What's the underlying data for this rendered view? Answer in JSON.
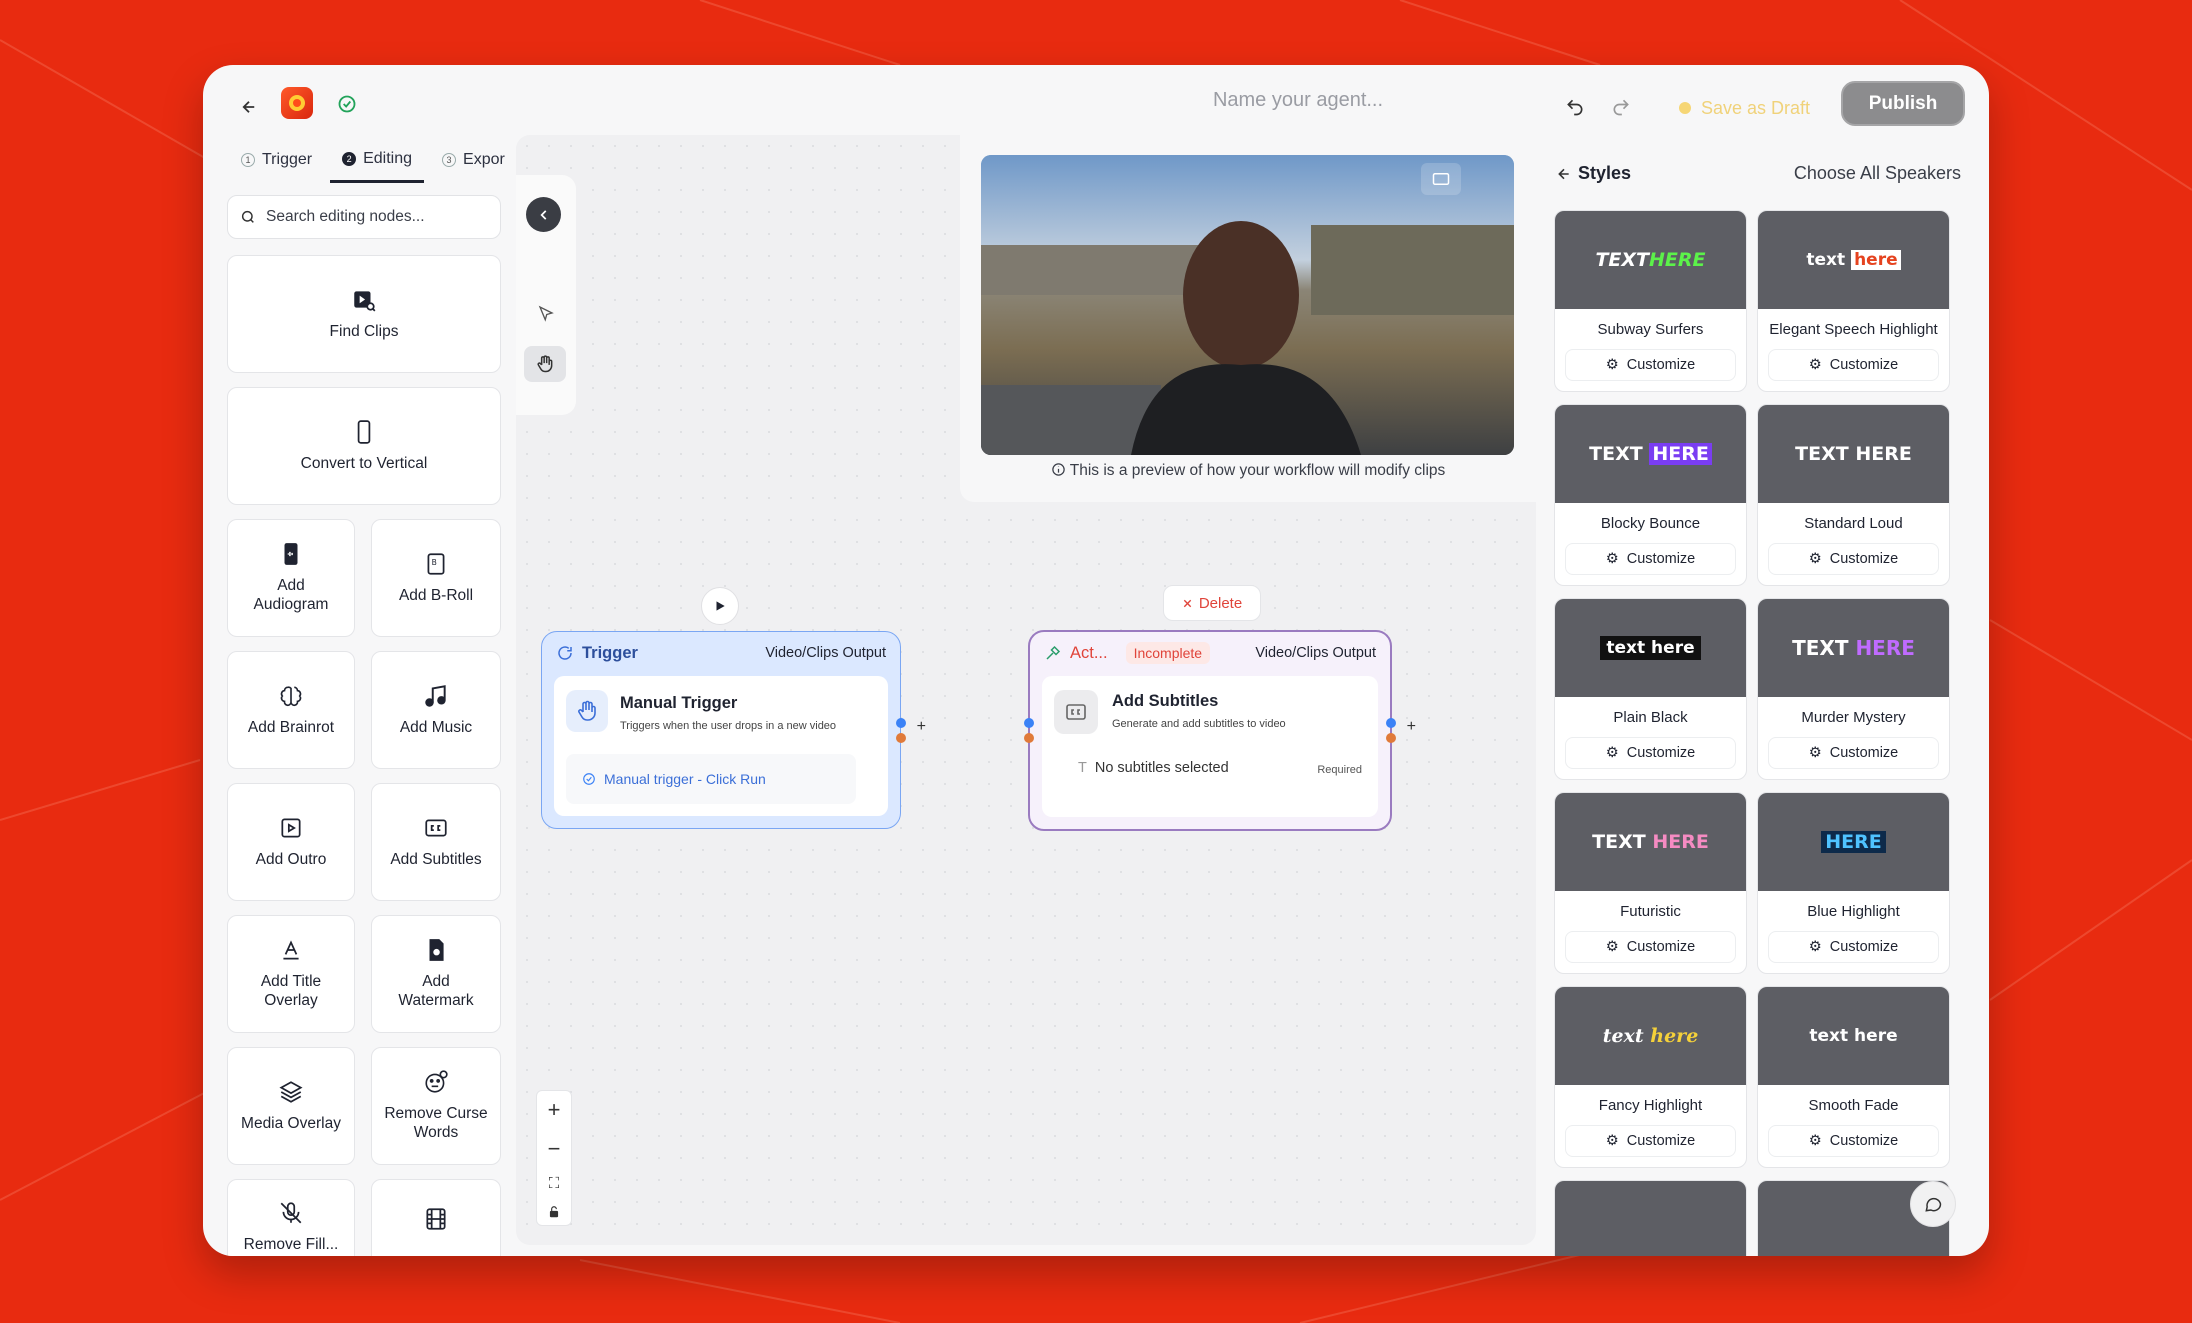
{
  "header": {
    "agent_name_placeholder": "Name your agent...",
    "save_draft_label": "Save as Draft",
    "publish_label": "Publish"
  },
  "left_panel": {
    "tabs": [
      {
        "num": "1",
        "label": "Trigger"
      },
      {
        "num": "2",
        "label": "Editing"
      },
      {
        "num": "3",
        "label": "Expor"
      }
    ],
    "search_placeholder": "Search editing nodes...",
    "nodes": [
      {
        "label": "Find Clips",
        "icon": "find-clips-icon"
      },
      {
        "label": "Convert to Vertical",
        "icon": "phone-icon"
      },
      {
        "label": "Add Audiogram",
        "icon": "audiogram-icon"
      },
      {
        "label": "Add B-Roll",
        "icon": "broll-icon"
      },
      {
        "label": "Add Brainrot",
        "icon": "brain-icon"
      },
      {
        "label": "Add Music",
        "icon": "music-icon"
      },
      {
        "label": "Add Outro",
        "icon": "outro-icon"
      },
      {
        "label": "Add Subtitles",
        "icon": "cc-icon"
      },
      {
        "label": "Add Title Overlay",
        "icon": "title-icon"
      },
      {
        "label": "Add Watermark",
        "icon": "watermark-icon"
      },
      {
        "label": "Media Overlay",
        "icon": "layers-icon"
      },
      {
        "label": "Remove Curse Words",
        "icon": "curse-icon"
      },
      {
        "label": "Remove Fill...",
        "icon": "mic-off-icon"
      },
      {
        "label": "",
        "icon": "film-icon"
      }
    ]
  },
  "preview": {
    "note": "This is a preview of how your workflow will modify clips"
  },
  "trigger_node": {
    "title": "Trigger",
    "output": "Video/Clips Output",
    "name": "Manual Trigger",
    "desc": "Triggers when the user drops in a new video",
    "link": "Manual trigger - Click Run"
  },
  "action_node": {
    "title": "Act...",
    "status": "Incomplete",
    "output": "Video/Clips Output",
    "name": "Add Subtitles",
    "desc": "Generate and add subtitles to video",
    "field": "No subtitles selected",
    "field_req": "Required",
    "delete_label": "Delete"
  },
  "styles_panel": {
    "back_label": "Styles",
    "choose_label": "Choose All Speakers",
    "customize_label": "Customize",
    "styles": [
      {
        "name": "Subway Surfers",
        "sample": "TEXT HERE"
      },
      {
        "name": "Elegant Speech Highlight",
        "sample": "text here"
      },
      {
        "name": "Blocky Bounce",
        "sample": "TEXT HERE"
      },
      {
        "name": "Standard Loud",
        "sample": "TEXT HERE"
      },
      {
        "name": "Plain Black",
        "sample": "text here"
      },
      {
        "name": "Murder Mystery",
        "sample": "TEXT HERE"
      },
      {
        "name": "Futuristic",
        "sample": "TEXT HERE"
      },
      {
        "name": "Blue Highlight",
        "sample": "HERE"
      },
      {
        "name": "Fancy Highlight",
        "sample": "text here"
      },
      {
        "name": "Smooth Fade",
        "sample": "text here"
      }
    ]
  },
  "colors": {
    "background": "#e82b10",
    "accent_blue": "#3b82f6",
    "danger": "#e0443a"
  }
}
